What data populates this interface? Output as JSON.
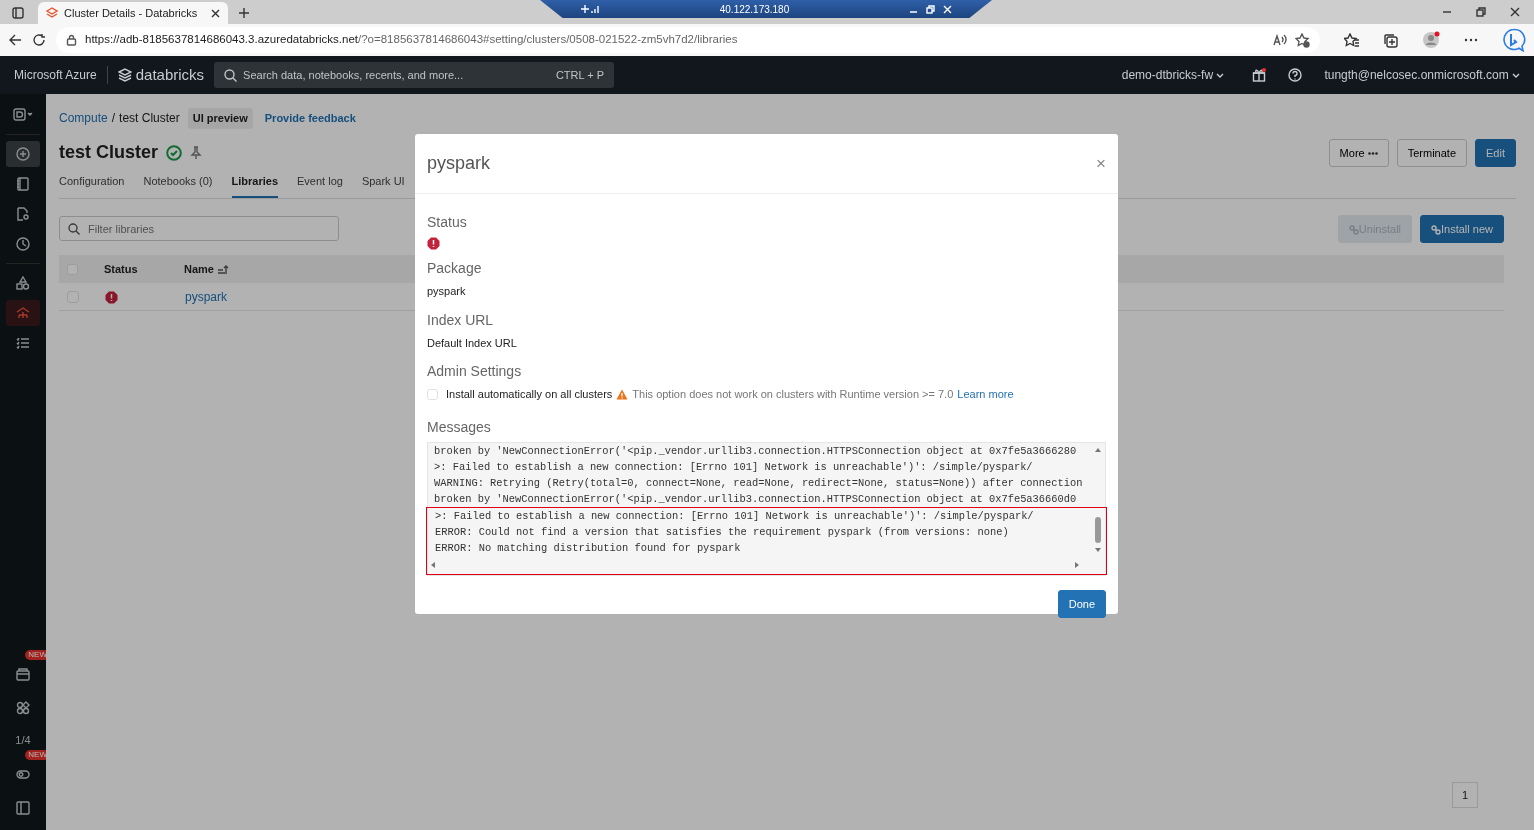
{
  "browser": {
    "tab_title": "Cluster Details - Databricks",
    "url_host": "https://adb-8185637814686043.3.azuredatabricks.net",
    "url_path": "/?o=8185637814686043#setting/clusters/0508-021522-zm5vh7d2/libraries",
    "remote_address": "40.122.173.180"
  },
  "header": {
    "brand": "Microsoft Azure",
    "product": "databricks",
    "search_placeholder": "Search data, notebooks, recents, and more...",
    "shortcut": "CTRL + P",
    "workspace": "demo-dtbricks-fw",
    "user": "tungth@nelcosec.onmicrosoft.com"
  },
  "sidebar": {
    "top": [
      {
        "selected": false
      },
      {
        "selected": false
      },
      {
        "selected": false
      },
      {
        "selected": false
      },
      {
        "selected": false
      },
      {
        "selected": false
      },
      {
        "selected": true
      },
      {
        "selected": false
      }
    ],
    "bottom": [
      {
        "selected": false,
        "badge": "NEW"
      },
      {
        "selected": false
      },
      {
        "selected": false,
        "label": "1/4"
      },
      {
        "selected": false,
        "badge": "NEW"
      },
      {
        "selected": false
      }
    ]
  },
  "breadcrumb": {
    "parent": "Compute",
    "separator": "/",
    "current": "test Cluster",
    "badge": "UI preview",
    "feedback_link": "Provide feedback"
  },
  "cluster": {
    "title": "test Cluster",
    "running": true
  },
  "actions": [
    "More",
    "Terminate",
    "Edit"
  ],
  "tabs": [
    {
      "label": "Configuration",
      "selected": false
    },
    {
      "label": "Notebooks (0)",
      "selected": false
    },
    {
      "label": "Libraries",
      "selected": true
    },
    {
      "label": "Event log",
      "selected": false
    },
    {
      "label": "Spark UI",
      "selected": false
    }
  ],
  "filter": {
    "placeholder": "Filter libraries"
  },
  "library_buttons": [
    {
      "label": "Uninstall",
      "disabled": true
    },
    {
      "label": "Install new",
      "disabled": false
    }
  ],
  "table": {
    "all_checked": false,
    "columns": [
      "Status",
      "Name"
    ],
    "rows": [
      {
        "checked": false,
        "error": true,
        "name": "pyspark"
      }
    ]
  },
  "pagination": {
    "page": "1"
  },
  "modal": {
    "title": "pyspark",
    "close": "×",
    "status_label": "Status",
    "status_error": true,
    "package_label": "Package",
    "package": "pyspark",
    "index_label": "Index URL",
    "index_url": "Default Index URL",
    "admin_label": "Admin Settings",
    "install_all": {
      "label": "Install automatically on all clusters",
      "checked": false
    },
    "warning": "This option does not work on clusters with Runtime version >= 7.0",
    "learn_more": "Learn more",
    "messages_label": "Messages",
    "messages": [
      {
        "text": "broken by 'NewConnectionError('<pip._vendor.urllib3.connection.HTTPSConnection object at 0x7fe5a3666280",
        "highlighted": false
      },
      {
        "text": ">: Failed to establish a new connection: [Errno 101] Network is unreachable')': /simple/pyspark/",
        "highlighted": false
      },
      {
        "text": "WARNING: Retrying (Retry(total=0, connect=None, read=None, redirect=None, status=None)) after connection",
        "highlighted": false
      },
      {
        "text": "broken by 'NewConnectionError('<pip._vendor.urllib3.connection.HTTPSConnection object at 0x7fe5a36660d0",
        "highlighted": false
      },
      {
        "text": ">: Failed to establish a new connection: [Errno 101] Network is unreachable')': /simple/pyspark/",
        "highlighted": true
      },
      {
        "text": "ERROR: Could not find a version that satisfies the requirement pyspark (from versions: none)",
        "highlighted": true
      },
      {
        "text": "ERROR: No matching distribution found for pyspark",
        "highlighted": true
      }
    ],
    "done": "Done"
  }
}
